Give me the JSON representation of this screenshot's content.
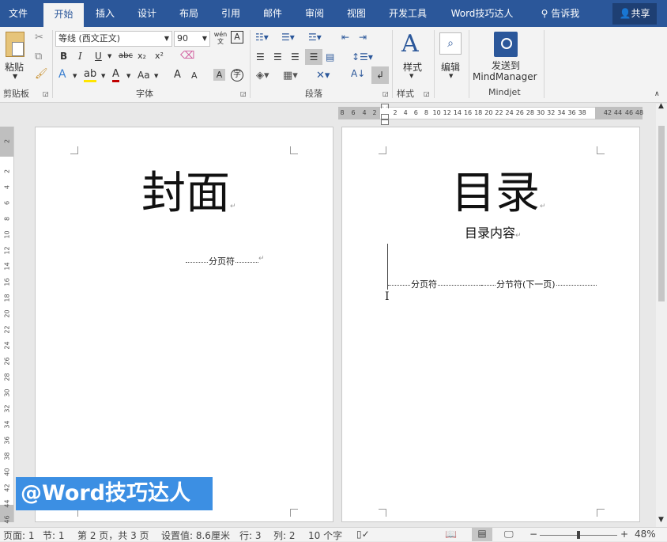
{
  "tabs": [
    "文件",
    "开始",
    "插入",
    "设计",
    "布局",
    "引用",
    "邮件",
    "审阅",
    "视图",
    "开发工具",
    "Word技巧达人"
  ],
  "tell_me": "告诉我",
  "share": "共享",
  "ribbon": {
    "clipboard": {
      "paste": "粘贴",
      "label": "剪贴板"
    },
    "font": {
      "name": "等线 (西文正文)",
      "size": "90",
      "label": "字体",
      "bold": "B",
      "italic": "I",
      "underline": "U",
      "strike": "abc",
      "sub": "x₂",
      "sup": "x²",
      "grow": "A",
      "shrink": "A",
      "case": "Aa",
      "wen": "wén"
    },
    "paragraph": {
      "label": "段落"
    },
    "styles": {
      "button": "样式",
      "label": "样式"
    },
    "editing": {
      "button": "编辑"
    },
    "mindjet": {
      "line1": "发送到",
      "line2": "MindManager",
      "label": "Mindjet"
    }
  },
  "ruler": {
    "h_left": [
      "8",
      "6",
      "4",
      "2"
    ],
    "h_mid": [
      "2",
      "4",
      "6",
      "8",
      "10",
      "12",
      "14",
      "16",
      "18",
      "20",
      "22",
      "24",
      "26",
      "28",
      "30",
      "32",
      "34",
      "36",
      "38"
    ],
    "h_right": [
      "42",
      "44",
      "46",
      "48"
    ],
    "v": [
      "2",
      "2",
      "4",
      "6",
      "8",
      "10",
      "12",
      "14",
      "16",
      "18",
      "20",
      "22",
      "24",
      "26",
      "28",
      "30",
      "32",
      "34",
      "36",
      "38",
      "40",
      "42",
      "44",
      "46"
    ]
  },
  "page1": {
    "title": "封面",
    "break": "分页符"
  },
  "page2": {
    "title": "目录",
    "subtitle": "目录内容",
    "break1": "分页符",
    "break2": "分节符(下一页)"
  },
  "para_mark": "↵",
  "status": {
    "page": "页面: 1",
    "section": "节: 1",
    "pos": "第 2 页，共 3 页",
    "setting": "设置值: 8.6厘米",
    "row": "行: 3",
    "col": "列: 2",
    "chars": "10 个字",
    "zoom": "48%",
    "minus": "−",
    "plus": "+"
  },
  "watermark": "@Word技巧达人",
  "colors": {
    "accent": "#2b579a",
    "watermark": "#3c8fe3"
  }
}
